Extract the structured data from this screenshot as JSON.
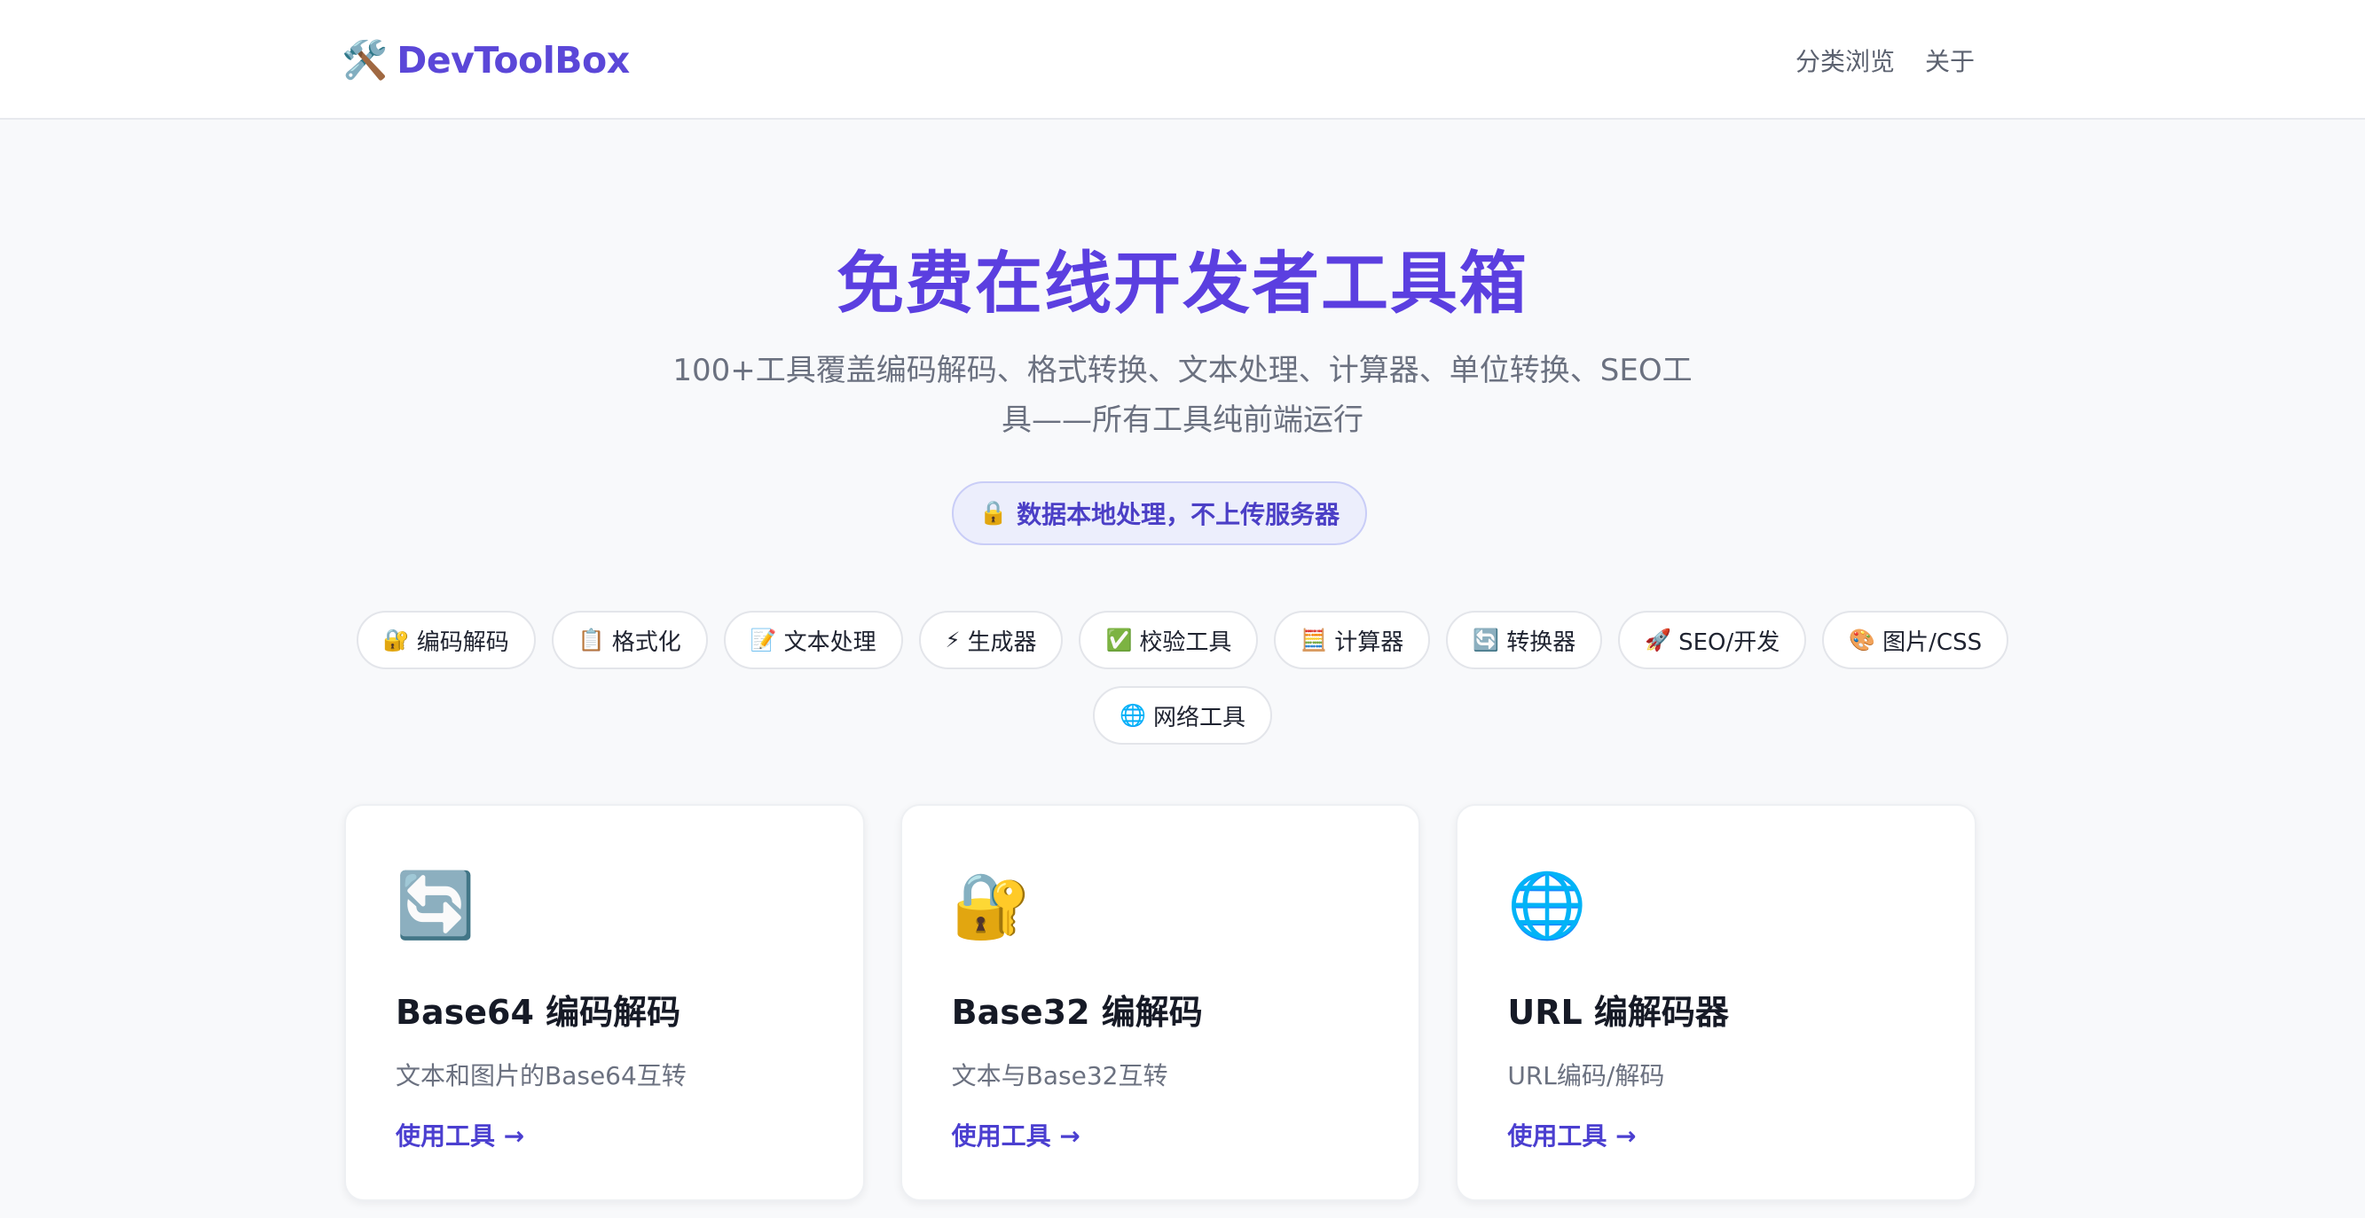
{
  "header": {
    "logo_icon": "🛠️",
    "logo_text": "DevToolBox",
    "nav": [
      {
        "label": "分类浏览"
      },
      {
        "label": "关于"
      }
    ]
  },
  "hero": {
    "title": "免费在线开发者工具箱",
    "subtitle_line1": "100+工具覆盖编码解码、格式转换、文本处理、计算器、单位转换、SEO工",
    "subtitle_line2": "具——所有工具纯前端运行",
    "privacy_icon": "🔒",
    "privacy_text": "数据本地处理，不上传服务器"
  },
  "categories": [
    {
      "icon": "🔐",
      "label": "编码解码"
    },
    {
      "icon": "📋",
      "label": "格式化"
    },
    {
      "icon": "📝",
      "label": "文本处理"
    },
    {
      "icon": "⚡",
      "label": "生成器"
    },
    {
      "icon": "✅",
      "label": "校验工具"
    },
    {
      "icon": "🧮",
      "label": "计算器"
    },
    {
      "icon": "🔄",
      "label": "转换器"
    },
    {
      "icon": "🚀",
      "label": "SEO/开发"
    },
    {
      "icon": "🎨",
      "label": "图片/CSS"
    },
    {
      "icon": "🌐",
      "label": "网络工具"
    }
  ],
  "tools": [
    {
      "icon": "🔄",
      "title": "Base64 编码解码",
      "desc": "文本和图片的Base64互转",
      "link": "使用工具 →"
    },
    {
      "icon": "🔐",
      "title": "Base32 编解码",
      "desc": "文本与Base32互转",
      "link": "使用工具 →"
    },
    {
      "icon": "🌐",
      "title": "URL 编解码器",
      "desc": "URL编码/解码",
      "link": "使用工具 →"
    }
  ],
  "colors": {
    "brand": "#5b47d8",
    "title": "#5b3fe0",
    "link": "#4b3fd0"
  }
}
